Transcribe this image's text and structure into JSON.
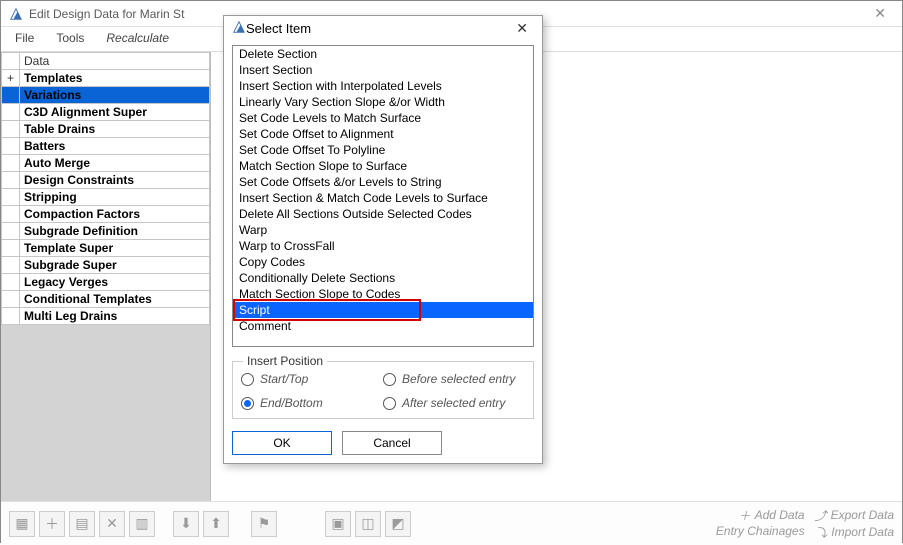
{
  "window": {
    "title": "Edit Design Data for Marin St"
  },
  "menu": {
    "file": "File",
    "tools": "Tools",
    "recalculate": "Recalculate"
  },
  "data_tree": {
    "header_blank": "",
    "header_data": "Data",
    "expand_symbol": "+",
    "rows": [
      "Templates",
      "Variations",
      "C3D Alignment Super",
      "Table Drains",
      "Batters",
      "Auto Merge",
      "Design Constraints",
      "Stripping",
      "Compaction Factors",
      "Subgrade Definition",
      "Template Super",
      "Subgrade Super",
      "Legacy Verges",
      "Conditional Templates",
      "Multi Leg Drains"
    ],
    "selected_index": 1
  },
  "dialog": {
    "title": "Select Item",
    "items": [
      "Delete Section",
      "Insert Section",
      "Insert Section with Interpolated Levels",
      "Linearly Vary Section Slope &/or Width",
      "Set Code Levels to Match Surface",
      "Set Code Offset to Alignment",
      "Set Code Offset To Polyline",
      "Match Section Slope to Surface",
      "Set Code Offsets &/or Levels to String",
      "Insert Section & Match Code Levels to Surface",
      "Delete All Sections Outside Selected Codes",
      "Warp",
      "Warp to CrossFall",
      "Copy Codes",
      "Conditionally Delete Sections",
      "Match Section Slope to Codes",
      "Script",
      "Comment"
    ],
    "selected_index": 16,
    "highlighted_index": 16,
    "group_label": "Insert Position",
    "radios": {
      "start": "Start/Top",
      "end": "End/Bottom",
      "before": "Before selected entry",
      "after": "After selected entry",
      "selected": "end"
    },
    "ok": "OK",
    "cancel": "Cancel"
  },
  "footer": {
    "add_data": "Add Data",
    "entry_chainages": "Entry Chainages",
    "export_data": "Export Data",
    "import_data": "Import Data"
  }
}
